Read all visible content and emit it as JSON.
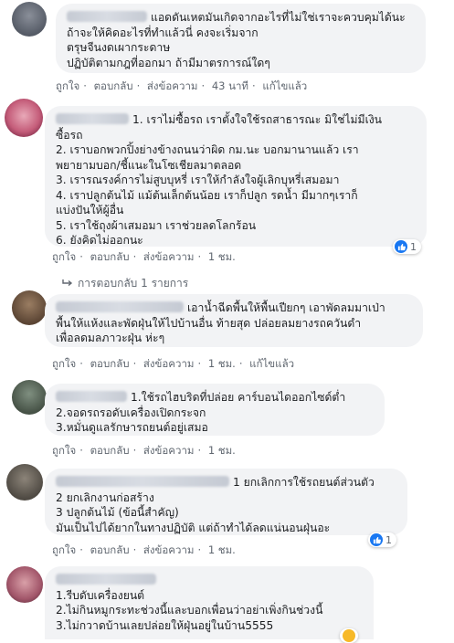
{
  "comments": [
    {
      "lines": [
        "แอดดันเหตมันเกิดจากอะไรที่ไม่ใช่เราจะควบคุมได้นะ",
        "ถ้าจะให้คิดอะไรที่ทำแล้วนี่ คงจะเริ่มจาก",
        "ตรุษจีนงดเผากระดาษ",
        "ปฏิบัติตามกฎที่ออกมา ถ้ามีมาตรการณ์ใดๆ"
      ],
      "actions": {
        "like": "ถูกใจ",
        "reply": "ตอบกลับ",
        "message": "ส่งข้อความ",
        "time": "43 นาที",
        "edited": "แก้ไขแล้ว"
      }
    },
    {
      "lines": [
        "1. เราไม่ซื้อรถ เราตั้งใจใช้รถสาธารณะ มิใช่ไม่มีเงิน",
        "ซื้อรถ",
        "2. เราบอกพวกปิ้งย่างข้างถนนว่าผิด กม.นะ บอกมานานแล้ว เรา",
        "พยายามบอก/ชี้แนะในโซเชียลมาตลอด",
        "3. เรารณรงค์การไม่สูบบุหรี่ เราให้กำลังใจผู้เลิกบุหรี่เสมอมา",
        "4. เราปลูกต้นไม้ แม้ต้นเล็กต้นน้อย เราก็ปลูก รดน้ำ มีมากๆเราก็",
        "แบ่งปันให้ผู้อื่น",
        "5. เราใช้ถุงผ้าเสมอมา เราช่วยลดโลกร้อน",
        "6. ยังคิดไม่ออกนะ"
      ],
      "actions": {
        "like": "ถูกใจ",
        "reply": "ตอบกลับ",
        "message": "ส่งข้อความ",
        "time": "1 ชม."
      },
      "reaction_count": "1",
      "replies_link": "การตอบกลับ 1 รายการ"
    },
    {
      "lines": [
        "เอาน้ำฉีดพื้นให้พื้นเปียกๆ เอาพัดลมมาเป่า",
        "พื้นให้แห้งและพัดฝุ่นให้ไปบ้านอื่น ท้ายสุด ปล่อยลมยางรถควันดำ",
        "เพื่อลดมลภาวะฝุ่น ห่ะๆ"
      ],
      "actions": {
        "like": "ถูกใจ",
        "reply": "ตอบกลับ",
        "message": "ส่งข้อความ",
        "time": "1 ชม.",
        "edited": "แก้ไขแล้ว"
      }
    },
    {
      "lines": [
        "1.ใช้รถไฮบริดที่ปล่อย คาร์บอนไดออกไซด์ต่ำ",
        "2.จอดรถรอดับเครื่องเปิดกระจก",
        "3.หมั่นดูแลรักษารถยนต์อยู่เสมอ"
      ],
      "actions": {
        "like": "ถูกใจ",
        "reply": "ตอบกลับ",
        "message": "ส่งข้อความ",
        "time": "1 ชม."
      }
    },
    {
      "lines": [
        "1 ยกเลิกการใช้รถยนต์ส่วนตัว",
        "2 ยกเลิกงานก่อสร้าง",
        "3 ปลูกต้นไม้ (ข้อนี้สำคัญ)",
        "มันเป็นไปได้ยากในทางปฏิบัติ แต่ถ้าทำได้ลดแน่นอนฝุ่นอะ"
      ],
      "actions": {
        "like": "ถูกใจ",
        "reply": "ตอบกลับ",
        "message": "ส่งข้อความ",
        "time": "1 ชม."
      },
      "reaction_count": "1"
    },
    {
      "lines": [
        "1.รีบดับเครื่องยนต์",
        "2.ไม่กินหมูกระทะช่วงนี้และบอกเพื่อนว่าอย่าเพิ่งกินช่วงนี้",
        "3.ไม่กวาดบ้านเลยปล่อยให้ฝุ่นอยู่ในบ้าน5555"
      ]
    }
  ],
  "colors": {
    "bubble": "#f2f3f5",
    "action_text": "#606770",
    "like_blue": "#1877f2"
  },
  "icons": {
    "like": "thumbs-up-icon",
    "reply_arrow": "reply-arrow-icon"
  }
}
